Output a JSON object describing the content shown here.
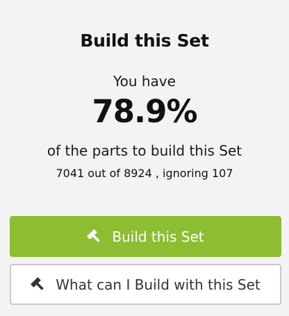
{
  "panel": {
    "title": "Build this Set",
    "you_have": "You have",
    "percent": "78.9%",
    "progress_fraction": 0.789,
    "description": "of the parts to build this Set",
    "counts_text": "7041 out of 8924 , ignoring 107"
  },
  "buttons": {
    "build_label": "Build this Set",
    "build_icon": "hammer-icon",
    "what_can_label": "What can I Build with this Set",
    "what_can_icon": "hammer-icon"
  },
  "colors": {
    "primary": "#8cbd32",
    "background": "#f3f3f3",
    "secondary_border": "#c9c9c9"
  }
}
